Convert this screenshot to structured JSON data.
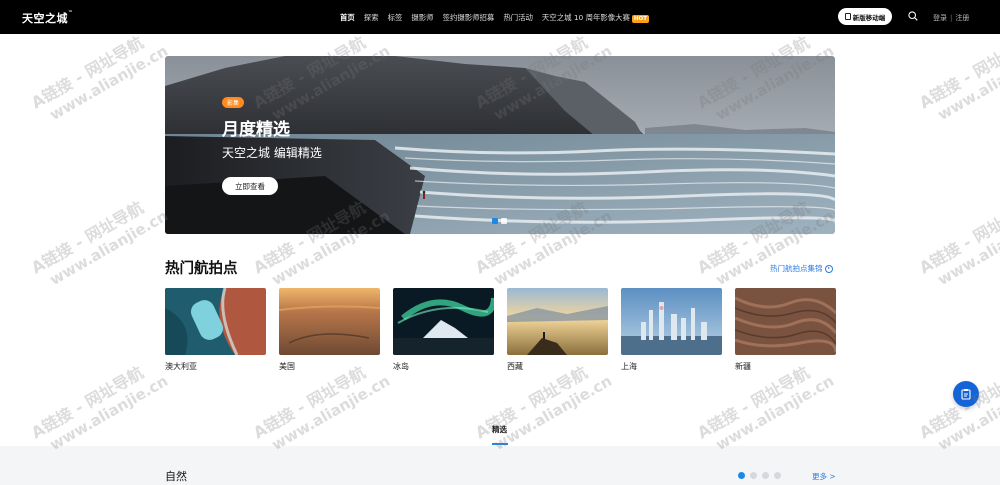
{
  "header": {
    "logo": "天空之城",
    "logo_mark": "™",
    "nav": [
      "首页",
      "探索",
      "标签",
      "摄影师",
      "签约摄影师招募",
      "热门活动",
      "天空之城 10 周年影像大赛"
    ],
    "hot_badge": "HOT",
    "mobile_button": "新版移动端",
    "login": "登录",
    "separator": "|",
    "register": "注册"
  },
  "hero": {
    "badge": "影集",
    "title": "月度精选",
    "subtitle": "天空之城 编辑精选",
    "button": "立即查看",
    "slide_count": 2,
    "active_slide": 1
  },
  "hot_spots": {
    "title": "热门航拍点",
    "link": "热门航拍点集锦",
    "items": [
      {
        "name": "澳大利亚",
        "icon": "australia-aerial-photo"
      },
      {
        "name": "美国",
        "icon": "usa-aerial-photo"
      },
      {
        "name": "冰岛",
        "icon": "iceland-aerial-photo"
      },
      {
        "name": "西藏",
        "icon": "tibet-aerial-photo"
      },
      {
        "name": "上海",
        "icon": "shanghai-aerial-photo"
      },
      {
        "name": "新疆",
        "icon": "xinjiang-aerial-photo"
      }
    ]
  },
  "tabs": {
    "active": "精选"
  },
  "category": {
    "title": "自然",
    "more": "更多 >",
    "page_count": 4,
    "active_page": 1
  },
  "watermark": {
    "line1": "A链接 - 网址导航",
    "line2": "www.alianjie.cn"
  },
  "colors": {
    "accent": "#1e88e5",
    "hot": "#ff9f1a",
    "badge": "#ff8a1e",
    "fab": "#1464d8"
  }
}
